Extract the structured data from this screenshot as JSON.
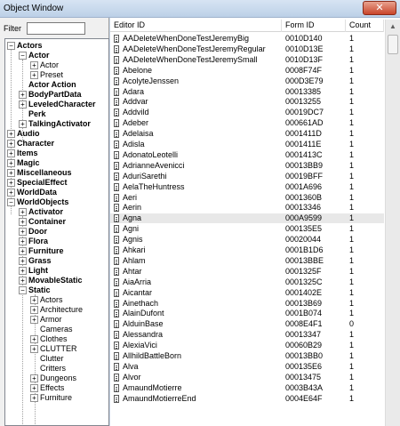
{
  "window": {
    "title": "Object Window",
    "close_glyph": "✕"
  },
  "filter": {
    "label": "Filter",
    "value": ""
  },
  "tree": [
    {
      "label": "Actors",
      "depth": 0,
      "exp": "−",
      "bold": true
    },
    {
      "label": "Actor",
      "depth": 1,
      "exp": "−",
      "bold": true
    },
    {
      "label": "Actor",
      "depth": 2,
      "exp": "+",
      "bold": false
    },
    {
      "label": "Preset",
      "depth": 2,
      "exp": "+",
      "bold": false
    },
    {
      "label": "Actor Action",
      "depth": 1,
      "exp": "",
      "bold": true
    },
    {
      "label": "BodyPartData",
      "depth": 1,
      "exp": "+",
      "bold": true
    },
    {
      "label": "LeveledCharacter",
      "depth": 1,
      "exp": "+",
      "bold": true
    },
    {
      "label": "Perk",
      "depth": 1,
      "exp": "",
      "bold": true
    },
    {
      "label": "TalkingActivator",
      "depth": 1,
      "exp": "+",
      "bold": true
    },
    {
      "label": "Audio",
      "depth": 0,
      "exp": "+",
      "bold": true
    },
    {
      "label": "Character",
      "depth": 0,
      "exp": "+",
      "bold": true
    },
    {
      "label": "Items",
      "depth": 0,
      "exp": "+",
      "bold": true
    },
    {
      "label": "Magic",
      "depth": 0,
      "exp": "+",
      "bold": true
    },
    {
      "label": "Miscellaneous",
      "depth": 0,
      "exp": "+",
      "bold": true
    },
    {
      "label": "SpecialEffect",
      "depth": 0,
      "exp": "+",
      "bold": true
    },
    {
      "label": "WorldData",
      "depth": 0,
      "exp": "+",
      "bold": true
    },
    {
      "label": "WorldObjects",
      "depth": 0,
      "exp": "−",
      "bold": true
    },
    {
      "label": "Activator",
      "depth": 1,
      "exp": "+",
      "bold": true
    },
    {
      "label": "Container",
      "depth": 1,
      "exp": "+",
      "bold": true
    },
    {
      "label": "Door",
      "depth": 1,
      "exp": "+",
      "bold": true
    },
    {
      "label": "Flora",
      "depth": 1,
      "exp": "+",
      "bold": true
    },
    {
      "label": "Furniture",
      "depth": 1,
      "exp": "+",
      "bold": true
    },
    {
      "label": "Grass",
      "depth": 1,
      "exp": "+",
      "bold": true
    },
    {
      "label": "Light",
      "depth": 1,
      "exp": "+",
      "bold": true
    },
    {
      "label": "MovableStatic",
      "depth": 1,
      "exp": "+",
      "bold": true
    },
    {
      "label": "Static",
      "depth": 1,
      "exp": "−",
      "bold": true
    },
    {
      "label": "Actors",
      "depth": 2,
      "exp": "+",
      "bold": false
    },
    {
      "label": "Architecture",
      "depth": 2,
      "exp": "+",
      "bold": false
    },
    {
      "label": "Armor",
      "depth": 2,
      "exp": "+",
      "bold": false
    },
    {
      "label": "Cameras",
      "depth": 2,
      "exp": "",
      "bold": false
    },
    {
      "label": "Clothes",
      "depth": 2,
      "exp": "+",
      "bold": false
    },
    {
      "label": "CLUTTER",
      "depth": 2,
      "exp": "+",
      "bold": false
    },
    {
      "label": "Clutter",
      "depth": 2,
      "exp": "",
      "bold": false
    },
    {
      "label": "Critters",
      "depth": 2,
      "exp": "",
      "bold": false
    },
    {
      "label": "Dungeons",
      "depth": 2,
      "exp": "+",
      "bold": false
    },
    {
      "label": "Effects",
      "depth": 2,
      "exp": "+",
      "bold": false
    },
    {
      "label": "Furniture",
      "depth": 2,
      "exp": "+",
      "bold": false
    }
  ],
  "list": {
    "columns": [
      "Editor ID",
      "Form ID",
      "Count"
    ],
    "selected_row": 17,
    "rows": [
      [
        "AADeleteWhenDoneTestJeremyBig",
        "0010D140",
        "1"
      ],
      [
        "AADeleteWhenDoneTestJeremyRegular",
        "0010D13E",
        "1"
      ],
      [
        "AADeleteWhenDoneTestJeremySmall",
        "0010D13F",
        "1"
      ],
      [
        "Abelone",
        "0008F74F",
        "1"
      ],
      [
        "AcolyteJenssen",
        "000D3E79",
        "1"
      ],
      [
        "Adara",
        "00013385",
        "1"
      ],
      [
        "Addvar",
        "00013255",
        "1"
      ],
      [
        "Addvild",
        "00019DC7",
        "1"
      ],
      [
        "Adeber",
        "000661AD",
        "1"
      ],
      [
        "Adelaisa",
        "0001411D",
        "1"
      ],
      [
        "Adisla",
        "0001411E",
        "1"
      ],
      [
        "AdonatoLeotelli",
        "0001413C",
        "1"
      ],
      [
        "AdrianneAvenicci",
        "00013BB9",
        "1"
      ],
      [
        "AduriSarethi",
        "00019BFF",
        "1"
      ],
      [
        "AelaTheHuntress",
        "0001A696",
        "1"
      ],
      [
        "Aeri",
        "0001360B",
        "1"
      ],
      [
        "Aerin",
        "00013346",
        "1"
      ],
      [
        "Agna",
        "000A9599",
        "1"
      ],
      [
        "Agni",
        "000135E5",
        "1"
      ],
      [
        "Agnis",
        "00020044",
        "1"
      ],
      [
        "Ahkari",
        "0001B1D6",
        "1"
      ],
      [
        "Ahlam",
        "00013BBE",
        "1"
      ],
      [
        "Ahtar",
        "0001325F",
        "1"
      ],
      [
        "AiaArria",
        "0001325C",
        "1"
      ],
      [
        "Aicantar",
        "0001402E",
        "1"
      ],
      [
        "Ainethach",
        "00013B69",
        "1"
      ],
      [
        "AlainDufont",
        "0001B074",
        "1"
      ],
      [
        "AlduinBase",
        "0008E4F1",
        "0"
      ],
      [
        "Alessandra",
        "00013347",
        "1"
      ],
      [
        "AlexiaVici",
        "00060B29",
        "1"
      ],
      [
        "AllhildBattleBorn",
        "00013BB0",
        "1"
      ],
      [
        "Alva",
        "000135E6",
        "1"
      ],
      [
        "Alvor",
        "00013475",
        "1"
      ],
      [
        "AmaundMotierre",
        "0003B43A",
        "1"
      ],
      [
        "AmaundMotierreEnd",
        "0004E64F",
        "1"
      ]
    ]
  }
}
